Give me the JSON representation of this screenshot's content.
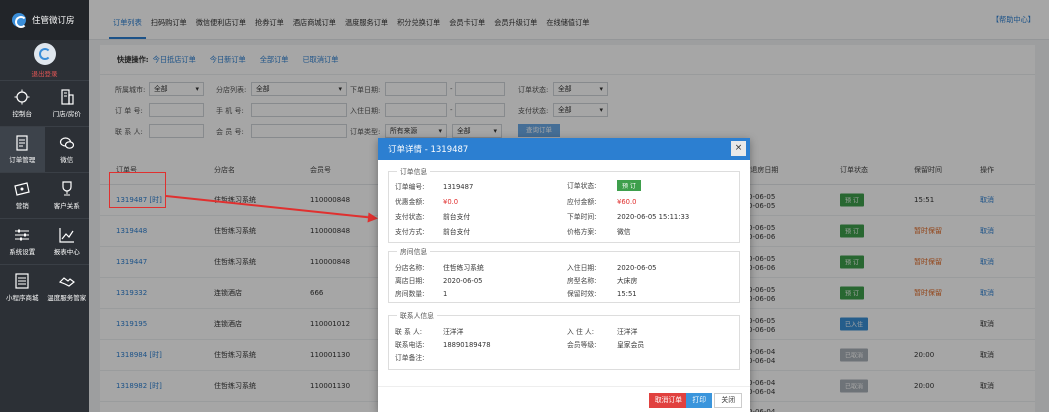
{
  "app": {
    "logo_text": "住管微订房",
    "help": "【帮助中心】"
  },
  "sidebar": {
    "logout": "退出登录",
    "items": [
      {
        "label": "控制台",
        "icon": "dashboard-icon"
      },
      {
        "label": "门店/房价",
        "icon": "building-icon"
      },
      {
        "label": "订单管理",
        "icon": "document-icon"
      },
      {
        "label": "微信",
        "icon": "wechat-icon"
      },
      {
        "label": "营销",
        "icon": "ticket-icon"
      },
      {
        "label": "客户关系",
        "icon": "trophy-icon"
      },
      {
        "label": "系统设置",
        "icon": "sliders-icon"
      },
      {
        "label": "报表中心",
        "icon": "chart-icon"
      },
      {
        "label": "小程序商城",
        "icon": "list-icon"
      },
      {
        "label": "温度服务管家",
        "icon": "handshake-icon"
      }
    ]
  },
  "topnav": {
    "tabs": [
      "订单列表",
      "扫码购订单",
      "微信便利店订单",
      "抢券订单",
      "酒店商城订单",
      "温度服务订单",
      "积分兑换订单",
      "会员卡订单",
      "会员升级订单",
      "在线储值订单"
    ]
  },
  "quick": {
    "label": "快捷操作:",
    "links": [
      "今日抵店订单",
      "今日新订单",
      "全部订单",
      "已取消订单"
    ]
  },
  "filters": {
    "city_label": "所属城市:",
    "city_value": "全部",
    "branch_label": "分店列表:",
    "branch_value": "全部",
    "order_date_label": "下单日期:",
    "order_status_label": "订单状态:",
    "order_status_value": "全部",
    "order_no_label": "订 单 号:",
    "phone_label": "手 机 号:",
    "checkin_date_label": "入住日期:",
    "pay_status_label": "支付状态:",
    "pay_status_value": "全部",
    "contact_label": "联 系 人:",
    "member_no_label": "会 员 号:",
    "order_type_label": "订单类型:",
    "order_type_value": "所有来源",
    "order_type_value2": "全部",
    "search_btn": "查询订单",
    "dash": "-"
  },
  "table": {
    "headers": {
      "order_no": "订单号",
      "branch": "分店名",
      "member": "会员号",
      "leave_date": "/退房日期",
      "status": "订单状态",
      "keep_time": "保留时间",
      "action": "操作"
    },
    "rows": [
      {
        "order_no": "1319487 [时]",
        "branch": "住哲练习系统",
        "member": "110000848",
        "d1": "0-06-05",
        "d2": "0-06-05",
        "status": "预 订",
        "status_color": "green",
        "keep": "15:51",
        "keep_warn": false,
        "action": "取消"
      },
      {
        "order_no": "1319448",
        "branch": "住哲练习系统",
        "member": "110000848",
        "d1": "0-06-05",
        "d2": "0-06-06",
        "status": "预 订",
        "status_color": "green",
        "keep": "暂时保留",
        "keep_warn": true,
        "action": "取消"
      },
      {
        "order_no": "1319447",
        "branch": "住哲练习系统",
        "member": "110000848",
        "d1": "0-06-05",
        "d2": "0-06-06",
        "status": "预 订",
        "status_color": "green",
        "keep": "暂时保留",
        "keep_warn": true,
        "action": "取消"
      },
      {
        "order_no": "1319332",
        "branch": "连锁酒店",
        "member": "666",
        "d1": "0-06-05",
        "d2": "0-06-06",
        "status": "预 订",
        "status_color": "green",
        "keep": "暂时保留",
        "keep_warn": true,
        "action": "取消"
      },
      {
        "order_no": "1319195",
        "branch": "连锁酒店",
        "member": "110001012",
        "d1": "0-06-05",
        "d2": "0-06-06",
        "status": "已入住",
        "status_color": "blue",
        "keep": "",
        "keep_warn": false,
        "action": "取消"
      },
      {
        "order_no": "1318984 [时]",
        "branch": "住哲练习系统",
        "member": "110001130",
        "d1": "0-06-04",
        "d2": "0-06-04",
        "status": "已取消",
        "status_color": "gray",
        "keep": "20:00",
        "keep_warn": false,
        "action": "取消"
      },
      {
        "order_no": "1318982 [时]",
        "branch": "住哲练习系统",
        "member": "110001130",
        "d1": "0-06-04",
        "d2": "0-06-04",
        "status": "已取消",
        "status_color": "gray",
        "keep": "20:00",
        "keep_warn": false,
        "action": "取消"
      }
    ],
    "partial_date": "0-06-04"
  },
  "modal": {
    "title": "订单详情 - 1319487",
    "close": "×",
    "order_info": {
      "legend": "订单信息",
      "order_no_k": "订单编号:",
      "order_no_v": "1319487",
      "discount_k": "优惠金额:",
      "discount_v": "¥0.0",
      "pay_status_k": "支付状态:",
      "pay_status_v": "前台支付",
      "pay_method_k": "支付方式:",
      "pay_method_v": "前台支付",
      "status_k": "订单状态:",
      "status_v": "预 订",
      "payable_k": "应付金额:",
      "payable_v": "¥60.0",
      "order_time_k": "下单时间:",
      "order_time_v": "2020-06-05 15:11:33",
      "price_plan_k": "价格方案:",
      "price_plan_v": "微信"
    },
    "room_info": {
      "legend": "房间信息",
      "branch_k": "分店名称:",
      "branch_v": "住哲练习系统",
      "leave_k": "离店日期:",
      "leave_v": "2020-06-05",
      "count_k": "房间数量:",
      "count_v": "1",
      "checkin_k": "入住日期:",
      "checkin_v": "2020-06-05",
      "type_k": "房型名称:",
      "type_v": "大床房",
      "keep_k": "保留时效:",
      "keep_v": "15:51"
    },
    "contact_info": {
      "legend": "联系人信息",
      "contact_k": "联 系 人:",
      "contact_v": "汪洋洋",
      "phone_k": "联系电话:",
      "phone_v": "18890189478",
      "remark_k": "订单备注:",
      "guest_k": "入 住 人:",
      "guest_v": "汪洋洋",
      "level_k": "会员等级:",
      "level_v": "皇家会员"
    },
    "buttons": {
      "cancel_order": "取消订单",
      "print": "打印",
      "close": "关闭"
    }
  }
}
